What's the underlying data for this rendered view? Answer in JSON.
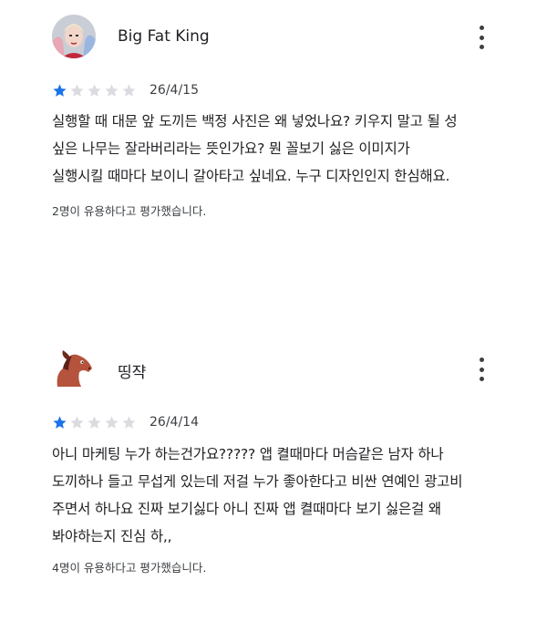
{
  "reviews": [
    {
      "author": "Big Fat King",
      "avatar": "user-photo-avatar",
      "rating": 1,
      "max_rating": 5,
      "date": "26/4/15",
      "lines": [
        "실행할 때 대문 앞 도끼든 백정 사진은 왜 넣었나요? 키우지 말고 될 성",
        "싶은 나무는 잘라버리라는 뜻인가요? 뭔 꼴보기 싫은 이미지가",
        "실행시킬 때마다 보이니 갈아타고 싶네요. 누구 디자인인지 한심해요."
      ],
      "helpful": "2명이 유용하다고 평가했습니다."
    },
    {
      "author": "띵쟉",
      "avatar": "horse-avatar",
      "rating": 1,
      "max_rating": 5,
      "date": "26/4/14",
      "lines": [
        "아니 마케팅 누가 하는건가요????? 앱 켤때마다 머슴같은 남자 하나",
        "도끼하나 들고 무섭게 있는데 저걸 누가 좋아한다고 비싼 연예인 광고비",
        "주면서 하나요 진짜 보기싫다 아니 진짜 앱 켤때마다 보기 싫은걸 왜",
        "봐야하는지 진심 하,,"
      ],
      "helpful": "4명이 유용하다고 평가했습니다."
    }
  ],
  "colors": {
    "star_filled": "#1a73e8",
    "star_empty": "#dadce0"
  },
  "icons": {
    "more": "more-vert-icon",
    "star": "star-icon"
  }
}
